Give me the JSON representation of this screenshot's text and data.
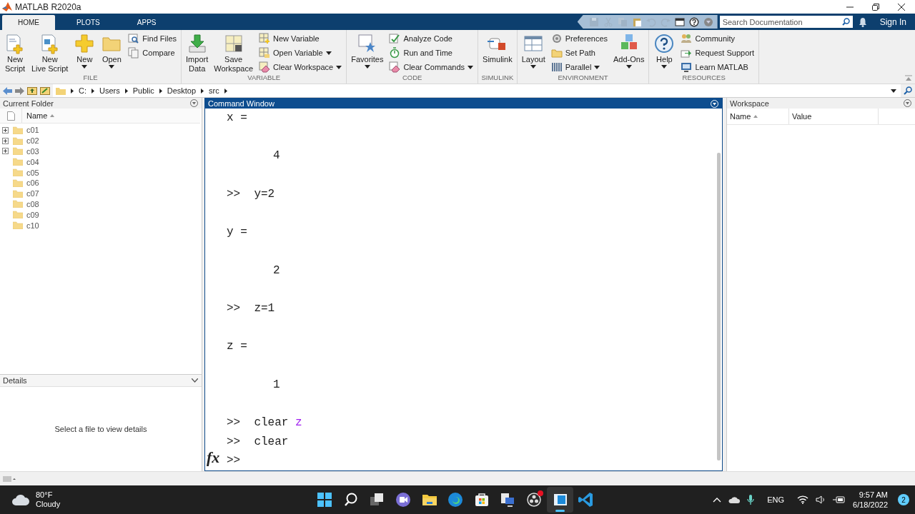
{
  "window": {
    "title": "MATLAB R2020a"
  },
  "tabs": [
    {
      "label": "HOME",
      "selected": true
    },
    {
      "label": "PLOTS",
      "selected": false
    },
    {
      "label": "APPS",
      "selected": false
    }
  ],
  "search": {
    "placeholder": "Search Documentation"
  },
  "sign_in": "Sign In",
  "ribbon": {
    "groups": [
      {
        "title": "FILE",
        "items": [
          {
            "kind": "large",
            "label": "New\nScript",
            "dropdown": false
          },
          {
            "kind": "large",
            "label": "New\nLive Script",
            "dropdown": false
          },
          {
            "kind": "large",
            "label": "New",
            "dropdown": true
          },
          {
            "kind": "large",
            "label": "Open",
            "dropdown": true
          },
          {
            "kind": "stack",
            "items": [
              {
                "label": "Find Files",
                "dropdown": false
              },
              {
                "label": "Compare",
                "dropdown": false
              }
            ]
          }
        ]
      },
      {
        "title": "VARIABLE",
        "items": [
          {
            "kind": "large",
            "label": "Import\nData",
            "dropdown": false
          },
          {
            "kind": "large",
            "label": "Save\nWorkspace",
            "dropdown": false
          },
          {
            "kind": "stack",
            "items": [
              {
                "label": "New Variable",
                "dropdown": false
              },
              {
                "label": "Open Variable",
                "dropdown": true
              },
              {
                "label": "Clear Workspace",
                "dropdown": true
              }
            ]
          }
        ]
      },
      {
        "title": "CODE",
        "items": [
          {
            "kind": "large",
            "label": "Favorites",
            "dropdown": true
          },
          {
            "kind": "stack",
            "items": [
              {
                "label": "Analyze Code",
                "dropdown": false
              },
              {
                "label": "Run and Time",
                "dropdown": false
              },
              {
                "label": "Clear Commands",
                "dropdown": true
              }
            ]
          }
        ]
      },
      {
        "title": "SIMULINK",
        "items": [
          {
            "kind": "large",
            "label": "Simulink",
            "dropdown": false
          }
        ]
      },
      {
        "title": "ENVIRONMENT",
        "items": [
          {
            "kind": "large",
            "label": "Layout",
            "dropdown": true
          },
          {
            "kind": "stack",
            "items": [
              {
                "label": "Preferences",
                "dropdown": false
              },
              {
                "label": "Set Path",
                "dropdown": false
              },
              {
                "label": "Parallel",
                "dropdown": true
              }
            ]
          },
          {
            "kind": "large",
            "label": "Add-Ons",
            "dropdown": true
          }
        ]
      },
      {
        "title": "RESOURCES",
        "items": [
          {
            "kind": "large",
            "label": "Help",
            "dropdown": true
          },
          {
            "kind": "stack",
            "items": [
              {
                "label": "Community",
                "dropdown": false
              },
              {
                "label": "Request Support",
                "dropdown": false
              },
              {
                "label": "Learn MATLAB",
                "dropdown": false
              }
            ]
          }
        ]
      }
    ]
  },
  "address": {
    "crumbs": [
      "C:",
      "Users",
      "Public",
      "Desktop",
      "src"
    ]
  },
  "current_folder": {
    "title": "Current Folder",
    "column": "Name",
    "items": [
      {
        "name": "c01",
        "expandable": true
      },
      {
        "name": "c02",
        "expandable": true
      },
      {
        "name": "c03",
        "expandable": true
      },
      {
        "name": "c04",
        "expandable": false
      },
      {
        "name": "c05",
        "expandable": false
      },
      {
        "name": "c06",
        "expandable": false
      },
      {
        "name": "c07",
        "expandable": false
      },
      {
        "name": "c08",
        "expandable": false
      },
      {
        "name": "c09",
        "expandable": false
      },
      {
        "name": "c10",
        "expandable": false
      }
    ]
  },
  "details": {
    "title": "Details",
    "message": "Select a file to view details"
  },
  "command_window": {
    "title": "Command Window",
    "function_hint": "fx",
    "lines": [
      {
        "kind": "output",
        "text": "x ="
      },
      {
        "kind": "value",
        "text": "4"
      },
      {
        "kind": "command",
        "prompt": ">>",
        "command": "y=2"
      },
      {
        "kind": "output",
        "text": "y ="
      },
      {
        "kind": "value",
        "text": "2"
      },
      {
        "kind": "command",
        "prompt": ">>",
        "command": "z=1"
      },
      {
        "kind": "output",
        "text": "z ="
      },
      {
        "kind": "value",
        "text": "1"
      },
      {
        "kind": "command",
        "prompt": ">>",
        "command": "clear",
        "argument": "z"
      },
      {
        "kind": "command",
        "prompt": ">>",
        "command": "clear"
      },
      {
        "kind": "prompt",
        "prompt": ">>"
      }
    ]
  },
  "workspace": {
    "title": "Workspace",
    "columns": [
      "Name",
      "Value"
    ]
  },
  "taskbar": {
    "weather": {
      "temperature": "80°F",
      "condition": "Cloudy"
    },
    "apps": [
      {
        "selected": false,
        "notification": false
      },
      {
        "selected": false,
        "notification": false
      },
      {
        "selected": false,
        "notification": false
      },
      {
        "selected": false,
        "notification": false
      },
      {
        "selected": false,
        "notification": false
      },
      {
        "selected": false,
        "notification": false
      },
      {
        "selected": false,
        "notification": false
      },
      {
        "selected": false,
        "notification": false
      },
      {
        "selected": false,
        "notification": true
      },
      {
        "selected": true,
        "notification": false
      },
      {
        "selected": false,
        "notification": false
      }
    ],
    "language": "ENG",
    "time": "9:57 AM",
    "date": "6/18/2022",
    "notification_count": "2"
  }
}
